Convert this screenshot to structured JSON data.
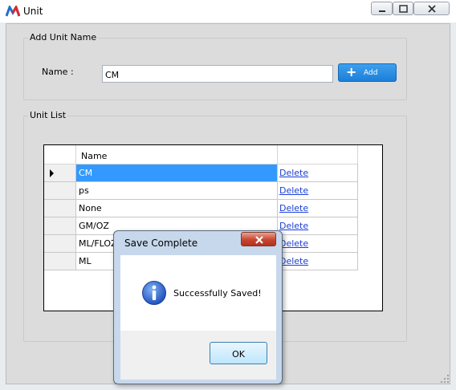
{
  "window": {
    "title": "Unit"
  },
  "add_group": {
    "legend": "Add Unit Name",
    "name_label": "Name  :",
    "name_value": "CM",
    "add_button": "Add"
  },
  "list_group": {
    "legend": "Unit List",
    "column_header": "Name",
    "rows": [
      {
        "name": "CM",
        "action": "Delete",
        "selected": true
      },
      {
        "name": "ps",
        "action": "Delete"
      },
      {
        "name": "None",
        "action": "Delete"
      },
      {
        "name": "GM/OZ",
        "action": "Delete"
      },
      {
        "name": "ML/FLOZ",
        "action": "Delete"
      },
      {
        "name": "ML",
        "action": "Delete"
      }
    ]
  },
  "dialog": {
    "title": "Save Complete",
    "message": "Successfully Saved!",
    "ok_button": "OK",
    "icon": "info-icon"
  },
  "colors": {
    "selection": "#3399ff",
    "add_button": "#1c7fd8",
    "link": "#1c3fd6"
  }
}
